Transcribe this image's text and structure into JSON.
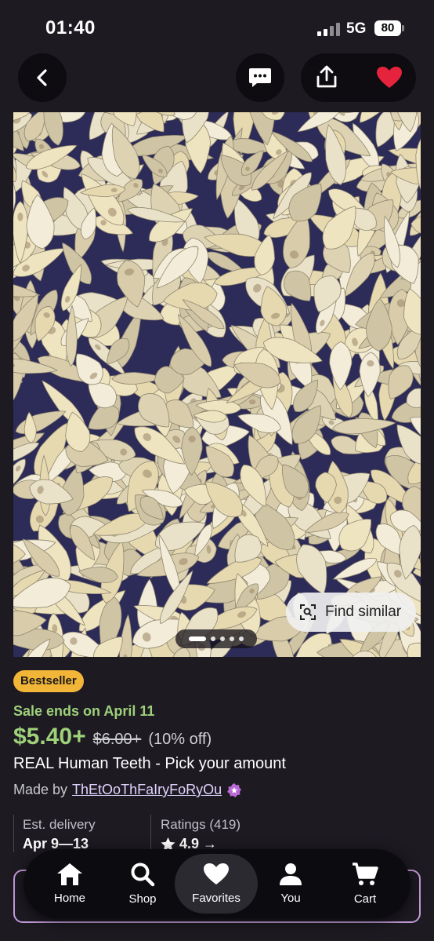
{
  "status": {
    "time": "01:40",
    "network": "5G",
    "battery": "80"
  },
  "top_actions": {
    "back_icon": "chevron-left-icon",
    "chat_icon": "message-icon",
    "share_icon": "share-icon",
    "favorite_icon": "heart-icon",
    "favorite_color": "#e5233d"
  },
  "gallery": {
    "find_similar_label": "Find similar",
    "dots_count": 5,
    "active_dot": 0
  },
  "listing": {
    "badge": "Bestseller",
    "sale_ends": "Sale ends on April 11",
    "price": "$5.40+",
    "original_price": "$6.00+",
    "discount": "(10% off)",
    "title": "REAL Human Teeth - Pick your amount",
    "made_by_prefix": "Made by",
    "shop_name": "ThEtOoThFaIryFoRyOu",
    "star_seller_icon": "star-seller-badge-icon"
  },
  "meta": {
    "delivery_label": "Est. delivery",
    "delivery_value": "Apr 9—13",
    "ratings_label": "Ratings (419)",
    "ratings_value": "4.9",
    "ratings_arrow": "→"
  },
  "nav": {
    "items": [
      {
        "label": "Home",
        "icon": "home-icon"
      },
      {
        "label": "Shop",
        "icon": "search-icon"
      },
      {
        "label": "Favorites",
        "icon": "heart-icon",
        "active": true
      },
      {
        "label": "You",
        "icon": "person-icon"
      },
      {
        "label": "Cart",
        "icon": "cart-icon"
      }
    ]
  },
  "colors": {
    "background": "#1d1a22",
    "sale_green": "#9ed17a",
    "badge_yellow": "#f1b537",
    "accent_purple": "#c29ad6"
  }
}
